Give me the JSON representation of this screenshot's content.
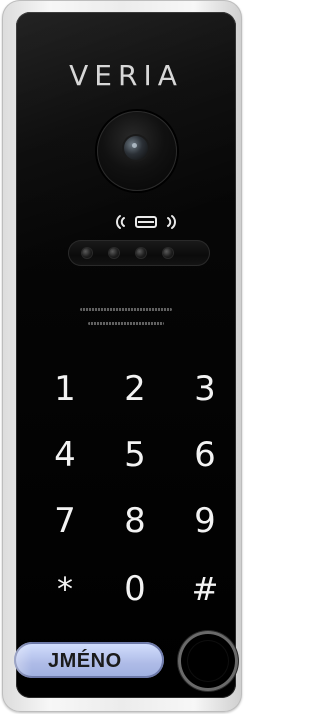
{
  "brand": {
    "logo_text": "VERIA"
  },
  "keypad": {
    "keys": [
      "1",
      "2",
      "3",
      "4",
      "5",
      "6",
      "7",
      "8",
      "9",
      "*",
      "0",
      "#"
    ]
  },
  "buttons": {
    "name_label": "JMÉNO"
  },
  "colors": {
    "panel": "#000000",
    "frame": "#e6e6e6",
    "name_button": "#b9c6f3",
    "key_text": "#f3f3f3"
  },
  "icons": {
    "camera": "camera-icon",
    "rfid": "rfid-card-icon",
    "call": "call-button-icon"
  }
}
